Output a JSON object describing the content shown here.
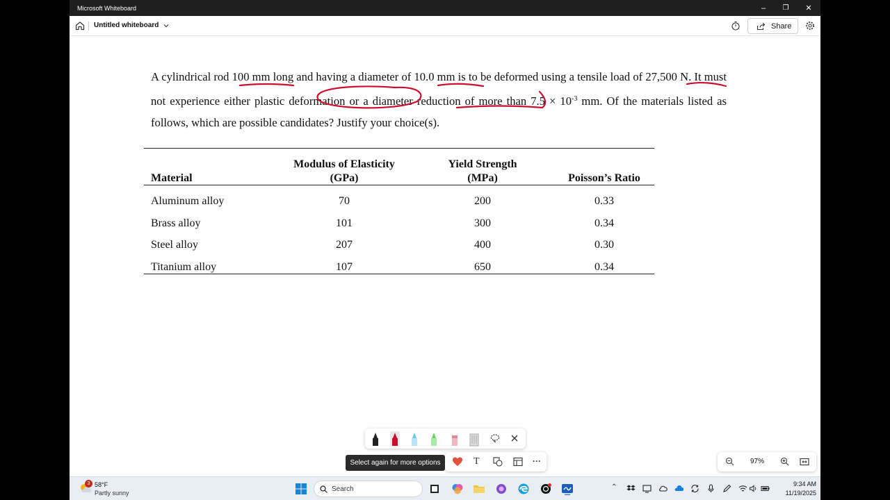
{
  "window": {
    "app_title": "Microsoft Whiteboard",
    "minimize_glyph": "–",
    "restore_glyph": "❐",
    "close_glyph": "✕"
  },
  "header": {
    "doc_title": "Untitled whiteboard",
    "share_label": "Share"
  },
  "problem": {
    "seg1": "A cylindrical rod 100 mm long and having a diameter of 10.0 mm is to be deformed using a tensile load of 27,500 N.  It must not experience either plastic deformation or a diameter reduction of more than 7.5 × 10",
    "sup": "-3",
    "seg2": " mm. Of the materials listed as follows, which are possible candidates?  Justify your choice(s)."
  },
  "table": {
    "headers": {
      "material": "Material",
      "modulus_l1": "Modulus of Elasticity",
      "modulus_l2": "(GPa)",
      "yield_l1": "Yield Strength",
      "yield_l2": "(MPa)",
      "poisson": "Poisson’s Ratio"
    },
    "rows": [
      {
        "material": "Aluminum alloy",
        "modulus": "70",
        "yield": "200",
        "poisson": "0.33"
      },
      {
        "material": "Brass alloy",
        "modulus": "101",
        "yield": "300",
        "poisson": "0.34"
      },
      {
        "material": "Steel alloy",
        "modulus": "207",
        "yield": "400",
        "poisson": "0.30"
      },
      {
        "material": "Titanium alloy",
        "modulus": "107",
        "yield": "650",
        "poisson": "0.34"
      }
    ]
  },
  "colors": {
    "ink": "#c8102e",
    "taskbar": "#e9eef5"
  },
  "tooltip": "Select again for more options",
  "toolbar": {
    "text_tool_glyph": "T",
    "more_glyph": "···"
  },
  "zoom": {
    "value": "97%"
  },
  "taskbar": {
    "weather_badge": "3",
    "weather_temp": "58°F",
    "weather_condition": "Partly sunny",
    "search_label": "Search",
    "time": "9:34 AM",
    "date": "11/19/2025"
  }
}
